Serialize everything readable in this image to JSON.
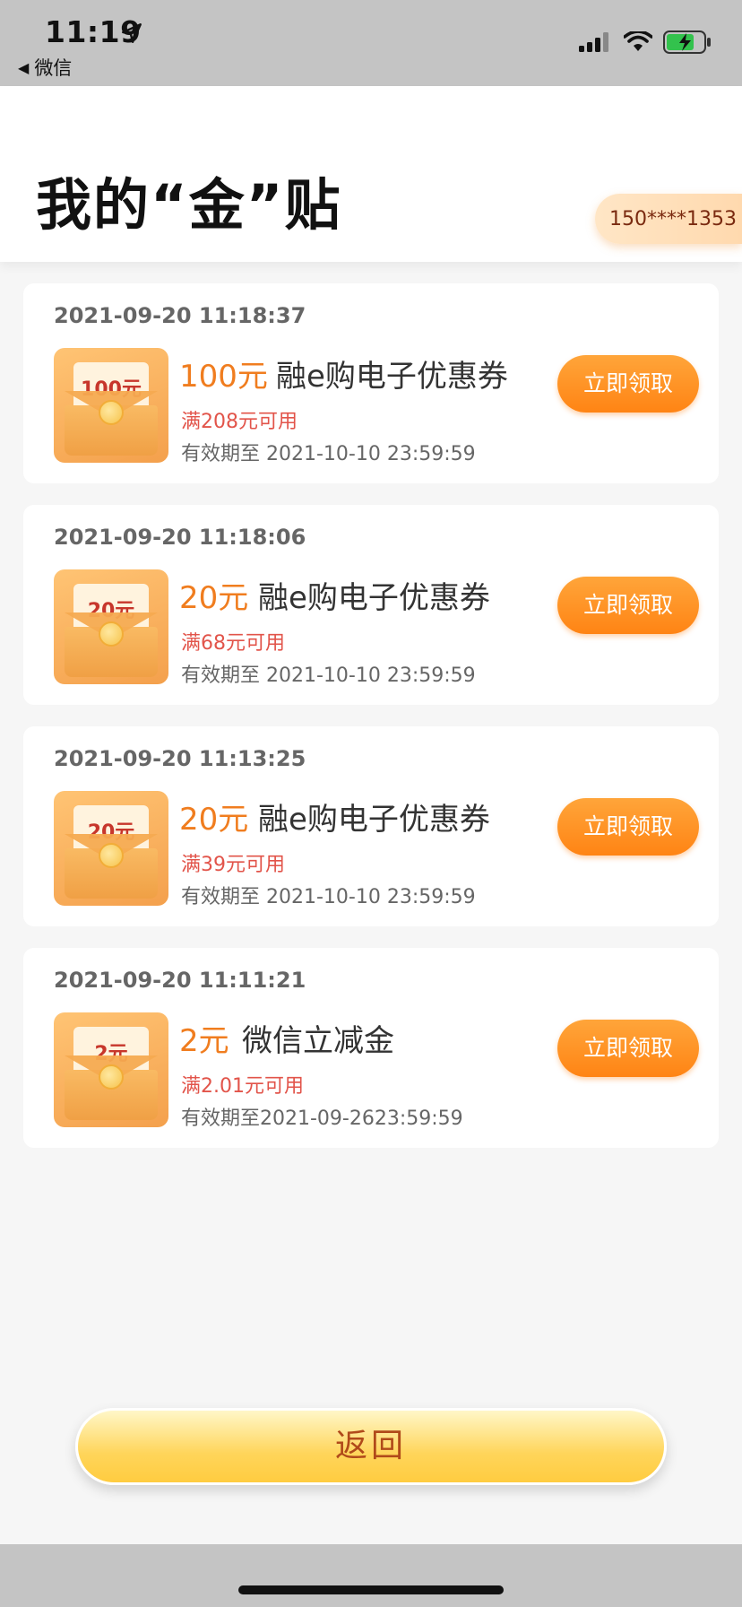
{
  "status_bar": {
    "time": "11:19",
    "back_label": "微信",
    "icons": [
      "location-arrow-icon",
      "cellular-signal-icon",
      "wifi-icon",
      "battery-charging-icon"
    ]
  },
  "header": {
    "title": "我的“金”贴",
    "phone": "150****1353"
  },
  "coupons": [
    {
      "time": "2021-09-20 11:18:37",
      "thumb_label": "100元",
      "amount": "100元",
      "name": "融e购电子优惠券",
      "condition": "满208元可用",
      "validity": "有效期至 2021-10-10 23:59:59",
      "button": "立即领取"
    },
    {
      "time": "2021-09-20 11:18:06",
      "thumb_label": "20元",
      "amount": "20元",
      "name": "融e购电子优惠券",
      "condition": "满68元可用",
      "validity": "有效期至 2021-10-10 23:59:59",
      "button": "立即领取"
    },
    {
      "time": "2021-09-20 11:13:25",
      "thumb_label": "20元",
      "amount": "20元",
      "name": "融e购电子优惠券",
      "condition": "满39元可用",
      "validity": "有效期至 2021-10-10 23:59:59",
      "button": "立即领取"
    },
    {
      "time": "2021-09-20 11:11:21",
      "thumb_label": "2元",
      "amount": "2元",
      "name": "微信立减金",
      "condition": "满2.01元可用",
      "validity": "有效期至2021-09-2623:59:59",
      "button": "立即领取"
    }
  ],
  "footer": {
    "return_label": "返回"
  },
  "colors": {
    "accent_orange": "#f07d1f",
    "condition_red": "#e2544a",
    "button_orange": "#ff8414",
    "return_gold": "#ffd55a"
  }
}
